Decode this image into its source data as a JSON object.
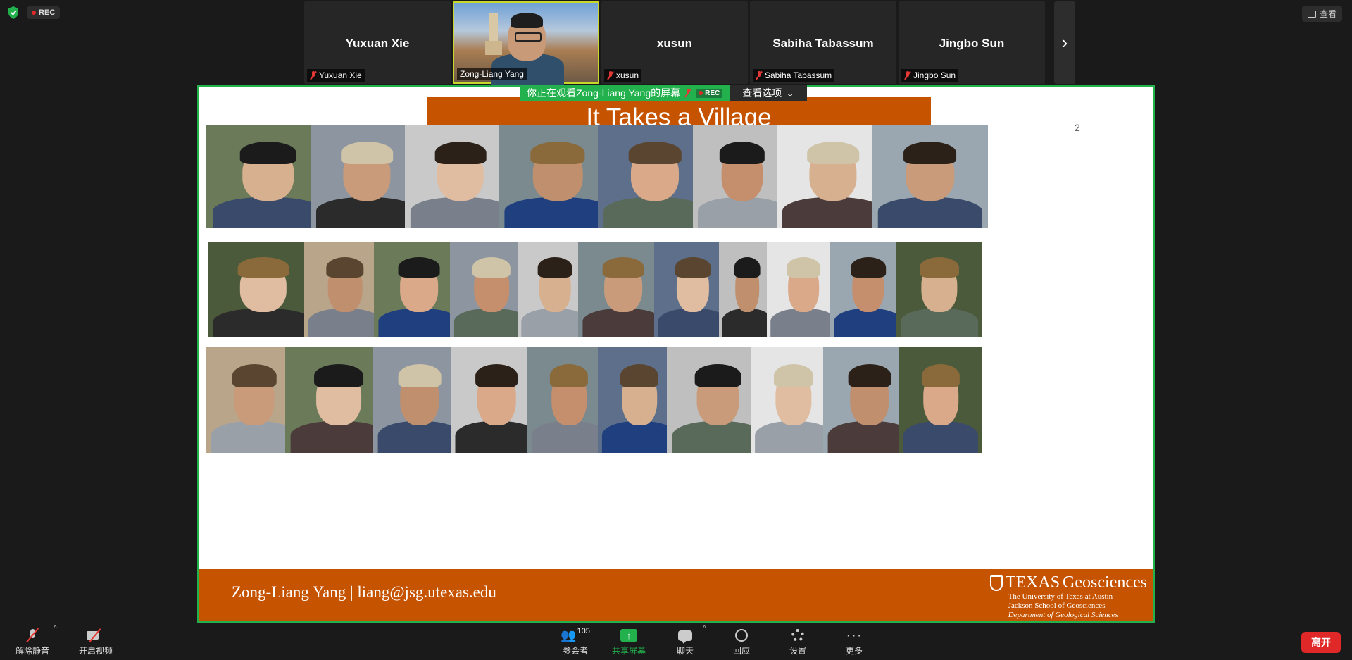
{
  "top": {
    "rec_label": "REC",
    "view_label": "查看"
  },
  "participants": [
    {
      "big_name": "Yuxuan Xie",
      "small_name": "Yuxuan Xie"
    },
    {
      "big_name": "",
      "small_name": "Zong-Liang Yang"
    },
    {
      "big_name": "xusun",
      "small_name": "xusun"
    },
    {
      "big_name": "Sabiha Tabassum",
      "small_name": "Sabiha Tabassum"
    },
    {
      "big_name": "Jingbo Sun",
      "small_name": "Jingbo Sun"
    }
  ],
  "share_banner": {
    "text": "你正在观看Zong-Liang Yang的屏幕",
    "rec": "REC",
    "options": "查看选项"
  },
  "slide": {
    "title": "It Takes a Village",
    "page_number": "2",
    "footer_name": "Zong-Liang Yang",
    "footer_sep": "|",
    "footer_email": "liang@jsg.utexas.edu",
    "brand_texas": "TEXAS",
    "brand_geo": "Geosciences",
    "brand_line2": "The University of Texas at Austin",
    "brand_line3": "Jackson School of Geosciences",
    "brand_line4": "Department of Geological Sciences"
  },
  "toolbar": {
    "unmute": "解除静音",
    "start_video": "开启视频",
    "participants": "参会者",
    "participant_count": "105",
    "share": "共享屏幕",
    "chat": "聊天",
    "reactions": "回应",
    "settings": "设置",
    "more": "更多",
    "leave": "离开"
  },
  "colors": {
    "accent_green": "#22b14c",
    "ut_orange": "#c65300",
    "leave_red": "#e02828"
  }
}
